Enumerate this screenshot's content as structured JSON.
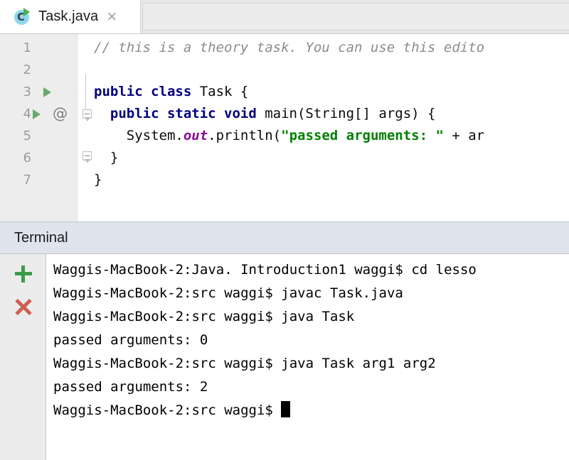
{
  "tab": {
    "label": "Task.java",
    "icon": "java-class-run-icon",
    "close_glyph": "×"
  },
  "editor": {
    "lines": [
      {
        "number": "1",
        "indent": 0,
        "tokens": [
          {
            "t": "// this is a theory task. You can use this edito",
            "c": "cmt"
          }
        ]
      },
      {
        "number": "2",
        "indent": 0,
        "tokens": []
      },
      {
        "number": "3",
        "indent": 0,
        "run_marker": true,
        "tokens": [
          {
            "t": "public class ",
            "c": "kw"
          },
          {
            "t": "Task {",
            "c": "plain"
          }
        ]
      },
      {
        "number": "4",
        "indent": 0,
        "run_marker": true,
        "at_marker": "@",
        "fold": "minus",
        "tokens": [
          {
            "t": "  ",
            "c": "plain"
          },
          {
            "t": "public static void ",
            "c": "kw"
          },
          {
            "t": "main(String[] args) {",
            "c": "plain"
          }
        ]
      },
      {
        "number": "5",
        "indent": 0,
        "tokens": [
          {
            "t": "    System.",
            "c": "plain"
          },
          {
            "t": "out",
            "c": "fld"
          },
          {
            "t": ".println(",
            "c": "plain"
          },
          {
            "t": "\"passed arguments: \"",
            "c": "str"
          },
          {
            "t": " + ar",
            "c": "plain"
          }
        ]
      },
      {
        "number": "6",
        "indent": 0,
        "fold": "end",
        "tokens": [
          {
            "t": "  }",
            "c": "plain"
          }
        ]
      },
      {
        "number": "7",
        "indent": 0,
        "tokens": [
          {
            "t": "}",
            "c": "plain"
          }
        ]
      }
    ]
  },
  "terminal": {
    "title": "Terminal",
    "add_icon": "plus-icon",
    "close_icon": "close-icon",
    "lines": [
      {
        "text": "Waggis-MacBook-2:Java. Introduction1 waggi$ cd lesso",
        "cursor": false
      },
      {
        "text": "Waggis-MacBook-2:src waggi$ javac Task.java",
        "cursor": false
      },
      {
        "text": "Waggis-MacBook-2:src waggi$ java Task",
        "cursor": false
      },
      {
        "text": "passed arguments: 0",
        "cursor": false
      },
      {
        "text": "Waggis-MacBook-2:src waggi$ java Task arg1 arg2",
        "cursor": false
      },
      {
        "text": "passed arguments: 2",
        "cursor": false
      },
      {
        "text": "Waggis-MacBook-2:src waggi$ ",
        "cursor": true
      }
    ]
  },
  "colors": {
    "keyword": "#000080",
    "string": "#008000",
    "comment": "#8c8c8c",
    "field": "#871094",
    "run_marker": "#6aa96f",
    "add_icon": "#3d9b4a",
    "close_icon": "#cf5f53",
    "terminal_header_bg": "#dfe3ec"
  }
}
